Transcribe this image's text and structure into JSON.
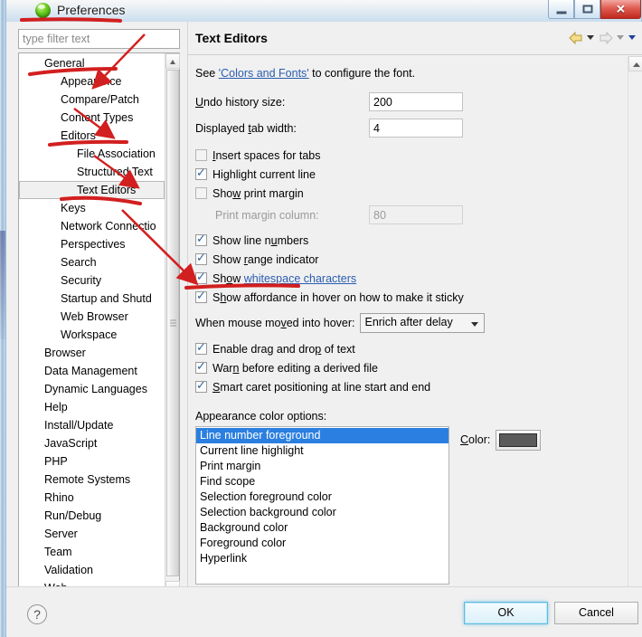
{
  "window": {
    "title": "Preferences",
    "icon": "green-sphere-icon",
    "controls": {
      "minimize": "–",
      "maximize": "□",
      "close": "✕"
    }
  },
  "filter": {
    "placeholder": "type filter text",
    "value": ""
  },
  "tree": {
    "items": [
      {
        "label": "General",
        "level": 1,
        "selected": false
      },
      {
        "label": "Appearance",
        "level": 2,
        "selected": false
      },
      {
        "label": "Compare/Patch",
        "level": 2,
        "selected": false
      },
      {
        "label": "Content Types",
        "level": 2,
        "selected": false
      },
      {
        "label": "Editors",
        "level": 2,
        "selected": false
      },
      {
        "label": "File Association",
        "level": 3,
        "selected": false
      },
      {
        "label": "Structured Text",
        "level": 3,
        "selected": false
      },
      {
        "label": "Text Editors",
        "level": 3,
        "selected": true
      },
      {
        "label": "Keys",
        "level": 2,
        "selected": false
      },
      {
        "label": "Network Connectio",
        "level": 2,
        "selected": false
      },
      {
        "label": "Perspectives",
        "level": 2,
        "selected": false
      },
      {
        "label": "Search",
        "level": 2,
        "selected": false
      },
      {
        "label": "Security",
        "level": 2,
        "selected": false
      },
      {
        "label": "Startup and Shutd",
        "level": 2,
        "selected": false
      },
      {
        "label": "Web Browser",
        "level": 2,
        "selected": false
      },
      {
        "label": "Workspace",
        "level": 2,
        "selected": false
      },
      {
        "label": "Browser",
        "level": 1,
        "selected": false
      },
      {
        "label": "Data Management",
        "level": 1,
        "selected": false
      },
      {
        "label": "Dynamic Languages",
        "level": 1,
        "selected": false
      },
      {
        "label": "Help",
        "level": 1,
        "selected": false
      },
      {
        "label": "Install/Update",
        "level": 1,
        "selected": false
      },
      {
        "label": "JavaScript",
        "level": 1,
        "selected": false
      },
      {
        "label": "PHP",
        "level": 1,
        "selected": false
      },
      {
        "label": "Remote Systems",
        "level": 1,
        "selected": false
      },
      {
        "label": "Rhino",
        "level": 1,
        "selected": false
      },
      {
        "label": "Run/Debug",
        "level": 1,
        "selected": false
      },
      {
        "label": "Server",
        "level": 1,
        "selected": false
      },
      {
        "label": "Team",
        "level": 1,
        "selected": false
      },
      {
        "label": "Validation",
        "level": 1,
        "selected": false
      },
      {
        "label": "Web",
        "level": 1,
        "selected": false
      }
    ]
  },
  "panel": {
    "title": "Text Editors",
    "nav": {
      "back": "back-arrow",
      "back_menu": "chevron-down",
      "forward": "forward-arrow",
      "forward_menu": "chevron-down",
      "view_menu": "chevron-down"
    },
    "see_prefix": "See ",
    "see_link": "'Colors and Fonts'",
    "see_suffix": " to configure the font.",
    "fields": [
      {
        "label": "Undo history size:",
        "value": "200",
        "disabled": false,
        "mnemonic": "U"
      },
      {
        "label": "Displayed tab width:",
        "value": "4",
        "disabled": false,
        "mnemonic": "t"
      }
    ],
    "checkboxes": [
      {
        "label": "Insert spaces for tabs",
        "checked": false
      },
      {
        "label": "Highlight current line",
        "checked": true
      },
      {
        "label": "Show print margin",
        "checked": false
      }
    ],
    "print_margin": {
      "label": "Print margin column:",
      "value": "80",
      "disabled": true
    },
    "checkboxes2": [
      {
        "label": "Show line numbers",
        "checked": true
      },
      {
        "label": "Show range indicator",
        "checked": true
      }
    ],
    "whitespace_row": {
      "prefix": "Show ",
      "link": "whitespace characters",
      "checked": true
    },
    "affordance_row": {
      "label": "Show affordance in hover on how to make it sticky",
      "checked": true
    },
    "hover": {
      "label": "When mouse moved into hover:",
      "value": "Enrich after delay"
    },
    "checkboxes3": [
      {
        "label": "Enable drag and drop of text",
        "checked": true
      },
      {
        "label": "Warn before editing a derived file",
        "checked": true
      },
      {
        "label": "Smart caret positioning at line start and end",
        "checked": true
      }
    ],
    "appearance_label": "Appearance color options:",
    "color_list": [
      {
        "label": "Line number foreground",
        "selected": true
      },
      {
        "label": "Current line highlight",
        "selected": false
      },
      {
        "label": "Print margin",
        "selected": false
      },
      {
        "label": "Find scope",
        "selected": false
      },
      {
        "label": "Selection foreground color",
        "selected": false
      },
      {
        "label": "Selection background color",
        "selected": false
      },
      {
        "label": "Background color",
        "selected": false
      },
      {
        "label": "Foreground color",
        "selected": false
      },
      {
        "label": "Hyperlink",
        "selected": false
      }
    ],
    "color_label": "Color:",
    "color_value": "#5a5a5a"
  },
  "footer": {
    "help": "?",
    "ok": "OK",
    "cancel": "Cancel"
  },
  "annotation_color": "#d21f1f"
}
